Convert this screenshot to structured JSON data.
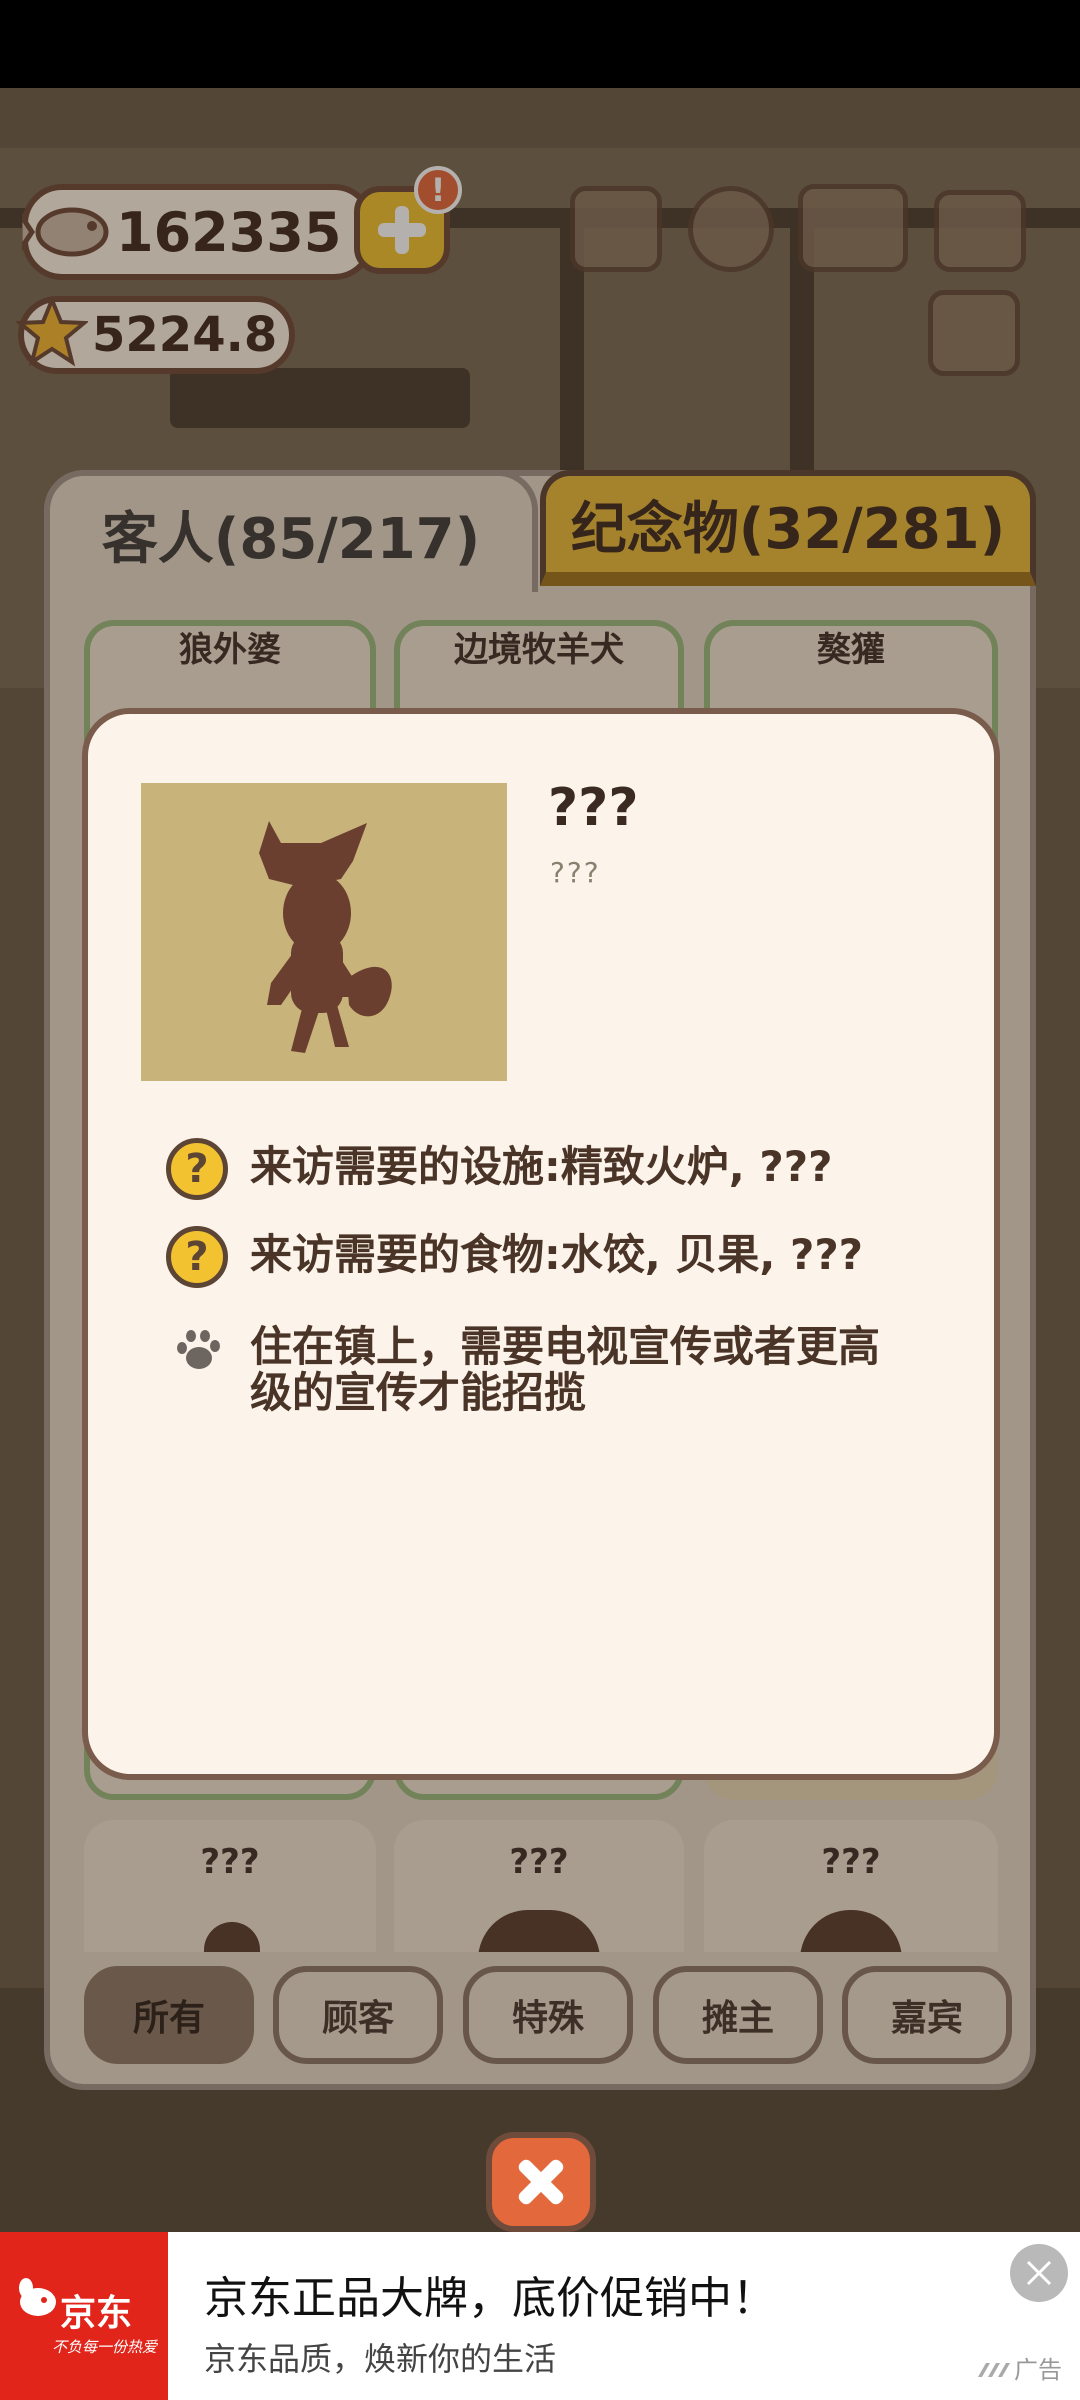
{
  "currency": {
    "fish": "162335",
    "stars": "5224.8",
    "alert_badge": "!"
  },
  "tabs": {
    "guests": "客人(85/217)",
    "souvenirs": "纪念物(32/281)"
  },
  "grid_top": [
    "狼外婆",
    "边境牧羊犬",
    "獒獾"
  ],
  "grid_bottom": [
    "???",
    "???",
    "???"
  ],
  "filters": [
    "所有",
    "顾客",
    "特殊",
    "摊主",
    "嘉宾"
  ],
  "modal": {
    "name": "???",
    "subtitle": "???",
    "requirements": [
      {
        "icon": "question-icon",
        "glyph": "?",
        "text": "来访需要的设施:精致火炉, ???"
      },
      {
        "icon": "question-icon",
        "glyph": "?",
        "text": "来访需要的食物:水饺, 贝果, ???"
      },
      {
        "icon": "paw-icon",
        "text": "住在镇上，需要电视宣传或者更高级的宣传才能招揽"
      }
    ]
  },
  "ad": {
    "brand": "京东",
    "slogan": "不负每一份热爱",
    "headline": "京东正品大牌，底价促销中！",
    "subline": "京东品质，焕新你的生活",
    "label": "广告"
  },
  "colors": {
    "accent_gold": "#e8bb3b",
    "close_orange": "#e3693c",
    "jd_red": "#e1251b",
    "portrait_bg": "#c8b47a"
  }
}
